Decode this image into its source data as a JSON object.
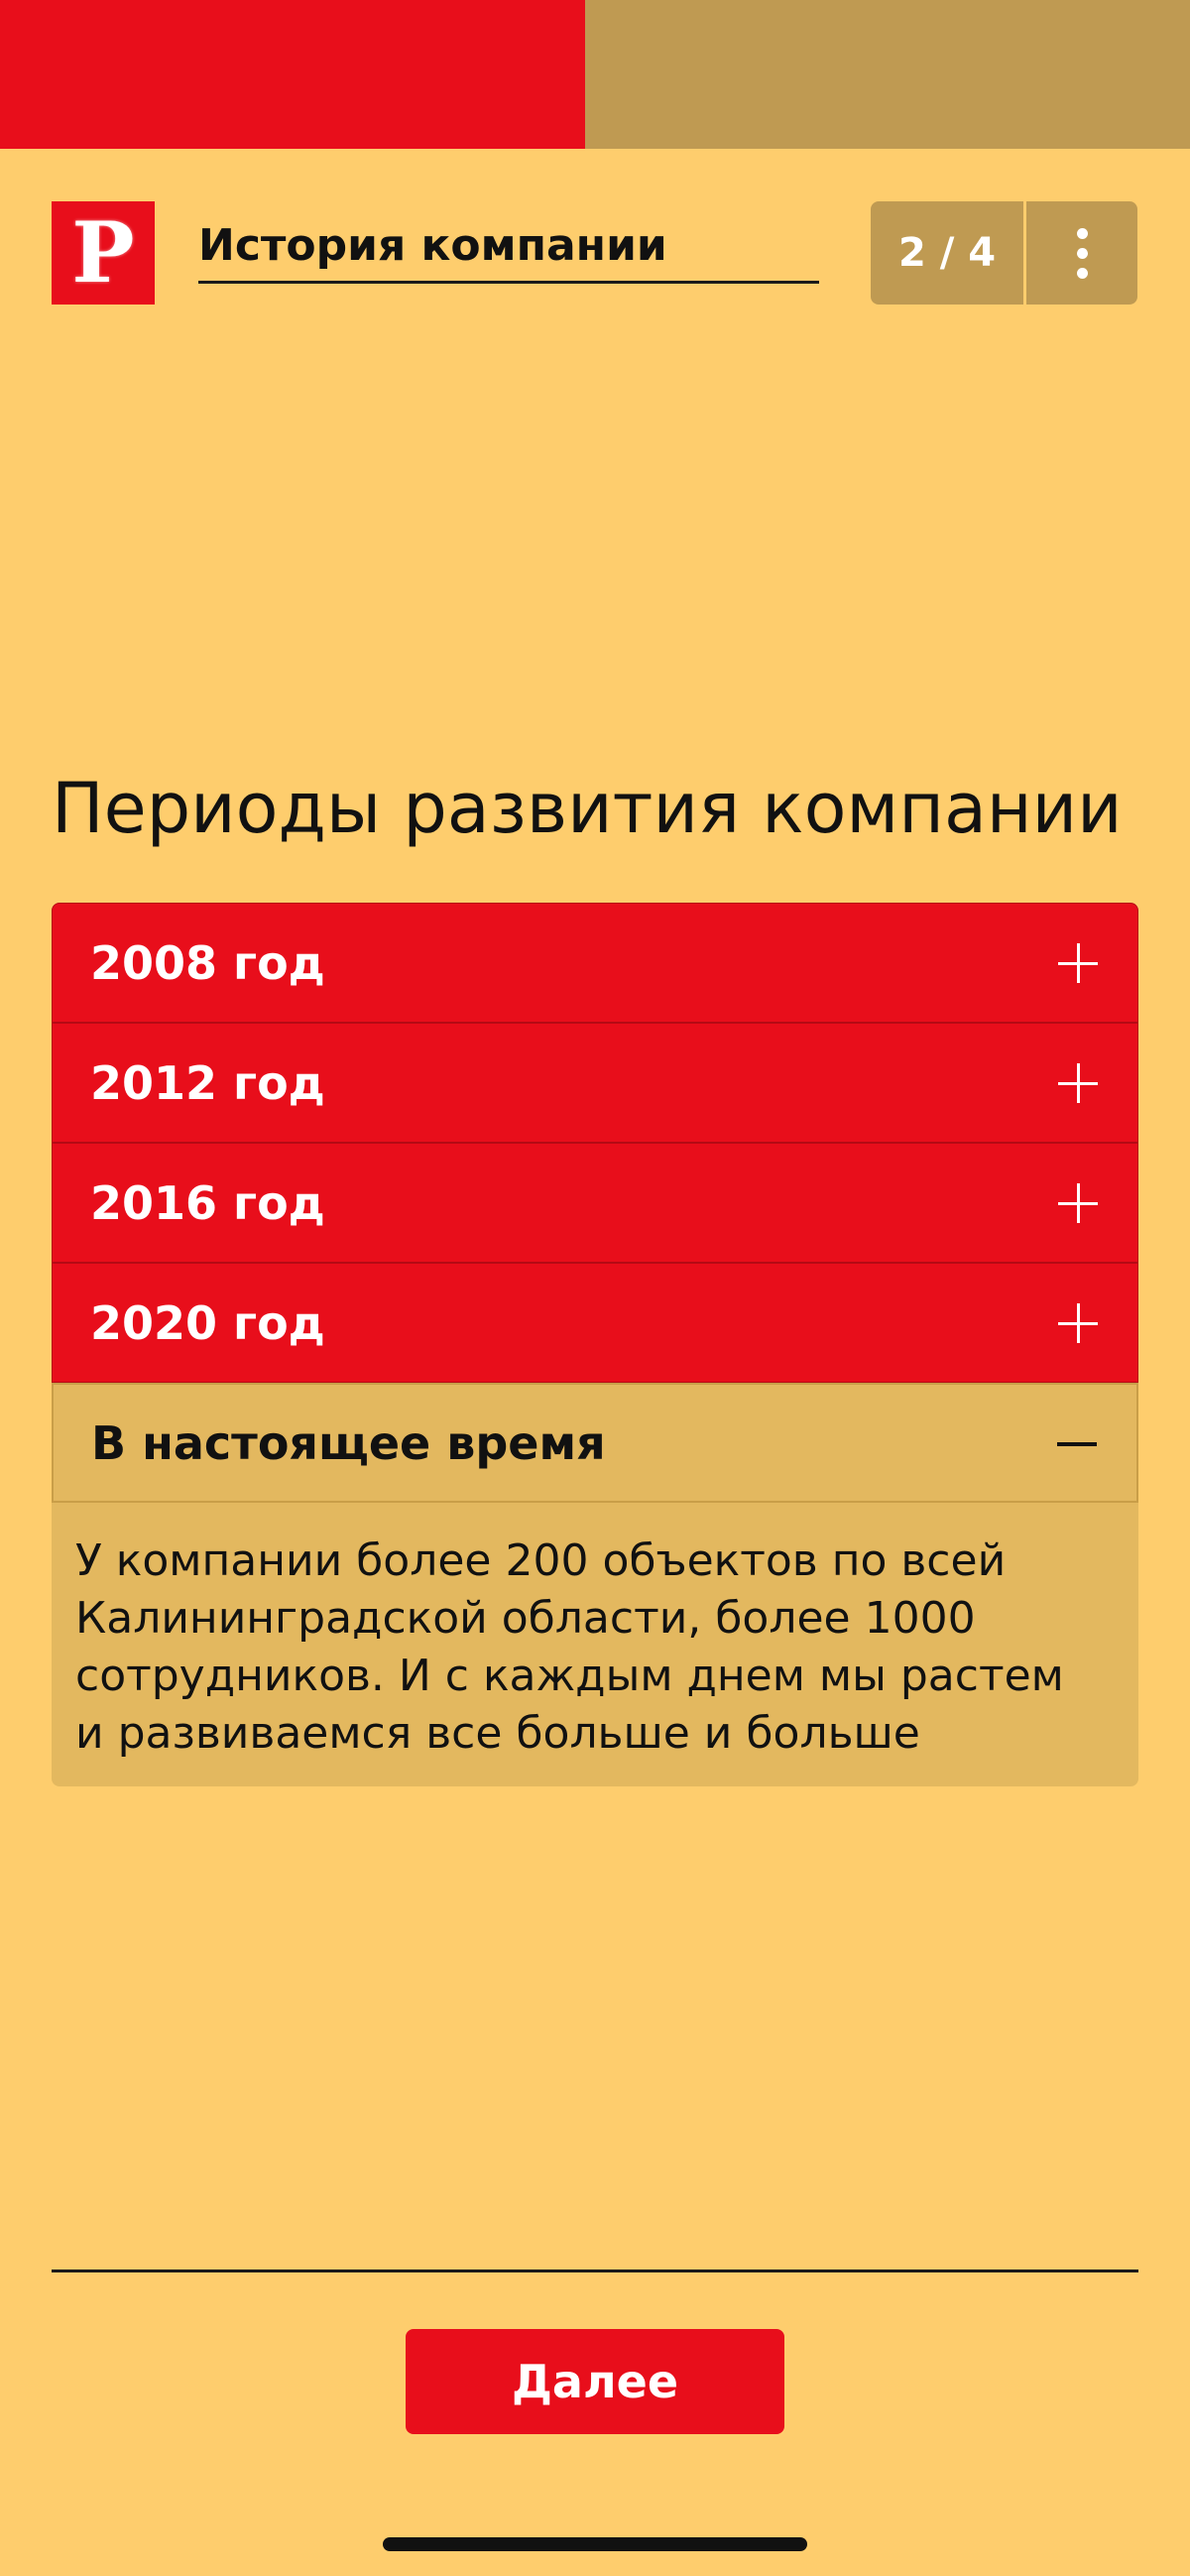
{
  "progress": {
    "completed_fraction": 0.5,
    "fill_color": "#E80E1B",
    "track_color": "#BF9A52"
  },
  "header": {
    "logo_letter": "P",
    "title": "История компании",
    "page_counter": "2 / 4",
    "menu_icon": "vertical-dots-icon"
  },
  "main": {
    "section_title": "Периоды развития компании",
    "accordion": [
      {
        "label": "2008 год",
        "state": "collapsed",
        "icon": "plus-icon"
      },
      {
        "label": "2012 год",
        "state": "collapsed",
        "icon": "plus-icon"
      },
      {
        "label": "2016 год",
        "state": "collapsed",
        "icon": "plus-icon"
      },
      {
        "label": "2020 год",
        "state": "collapsed",
        "icon": "plus-icon"
      },
      {
        "label": "В настоящее время",
        "state": "expanded",
        "icon": "minus-icon",
        "body": "У компании более 200 объектов по всей Калининградской области, более 1000 сотрудников. И с каждым днем мы растем и развиваемся все больше и больше"
      }
    ]
  },
  "footer": {
    "next_label": "Далее"
  },
  "colors": {
    "background": "#FECD6D",
    "accent_red": "#E80E1B",
    "gold": "#BF9A52",
    "expanded_panel": "#E3B85F"
  }
}
